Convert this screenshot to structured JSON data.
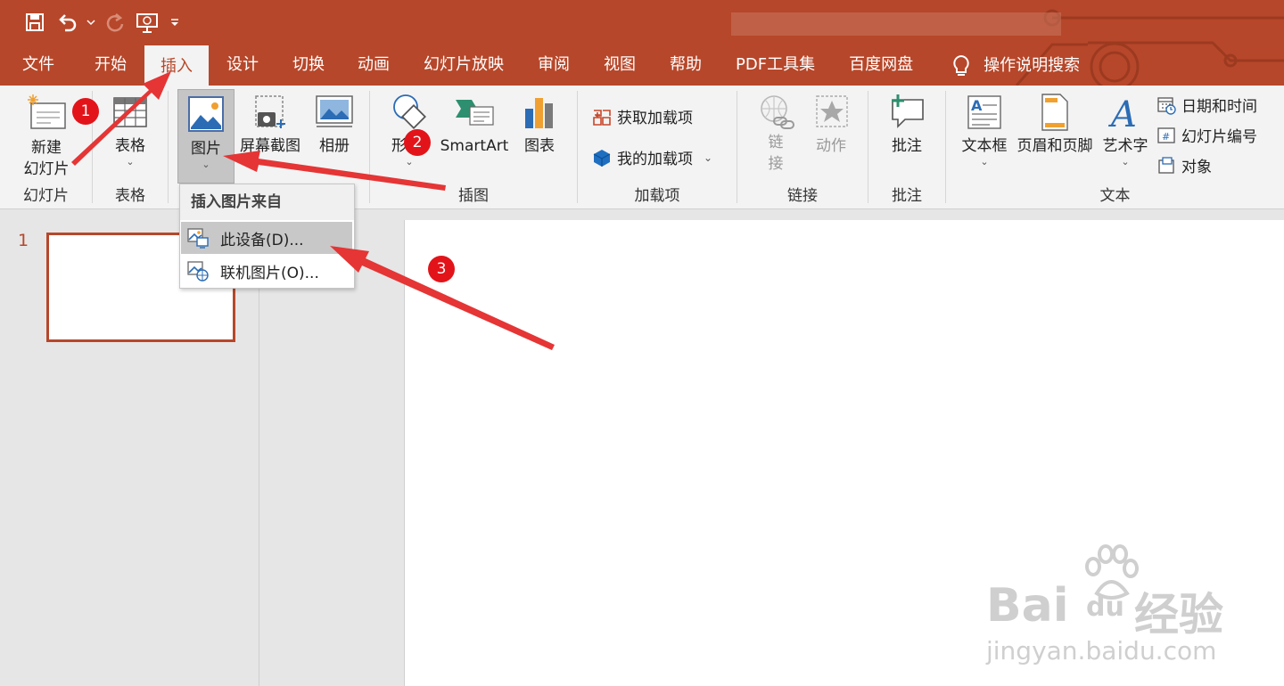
{
  "colors": {
    "accent": "#b7472a",
    "ribbon_bg": "#f3f3f3",
    "badge": "#e2141a",
    "arrow": "#e53535"
  },
  "qat": {
    "items": [
      {
        "icon": "save-icon"
      },
      {
        "icon": "undo-icon"
      },
      {
        "icon": "redo-icon"
      },
      {
        "icon": "present-from-start-icon"
      },
      {
        "icon": "customize-qat-icon"
      }
    ]
  },
  "tabs": [
    {
      "label": "文件",
      "active": false
    },
    {
      "label": "开始",
      "active": false
    },
    {
      "label": "插入",
      "active": true
    },
    {
      "label": "设计",
      "active": false
    },
    {
      "label": "切换",
      "active": false
    },
    {
      "label": "动画",
      "active": false
    },
    {
      "label": "幻灯片放映",
      "active": false
    },
    {
      "label": "审阅",
      "active": false
    },
    {
      "label": "视图",
      "active": false
    },
    {
      "label": "帮助",
      "active": false
    },
    {
      "label": "PDF工具集",
      "active": false
    },
    {
      "label": "百度网盘",
      "active": false
    }
  ],
  "tell_me": {
    "icon": "lightbulb-icon",
    "label": "操作说明搜索"
  },
  "ribbon": {
    "slides_group": {
      "label": "幻灯片",
      "new_slide_line1": "新建",
      "new_slide_line2": "幻灯片"
    },
    "tables_group": {
      "label": "表格",
      "table": "表格"
    },
    "images_group": {
      "pictures": "图片",
      "screenshot": "屏幕截图",
      "album": "相册"
    },
    "illustrations_group": {
      "label": "插图",
      "shapes": "形",
      "smartart": "SmartArt",
      "chart": "图表"
    },
    "addins_group": {
      "label": "加载项",
      "get_addins": "获取加载项",
      "my_addins": "我的加载项"
    },
    "links_group": {
      "label": "链接",
      "link_line1": "链",
      "link_line2": "接",
      "action": "动作"
    },
    "comments_group": {
      "label": "批注",
      "comment": "批注"
    },
    "text_group": {
      "label": "文本",
      "textbox": "文本框",
      "header_footer": "页眉和页脚",
      "wordart": "艺术字",
      "datetime": "日期和时间",
      "slide_number": "幻灯片编号",
      "object": "对象"
    }
  },
  "dropdown": {
    "header": "插入图片来自",
    "items": [
      {
        "label": "此设备(D)...",
        "icon": "this-device-icon"
      },
      {
        "label": "联机图片(O)...",
        "icon": "online-pictures-icon"
      }
    ]
  },
  "slides_pane": {
    "slide_number": "1"
  },
  "annotations": {
    "badge1": "1",
    "badge2": "2",
    "badge3": "3"
  },
  "watermark": {
    "brand": "Bai",
    "brand2": "du",
    "cn": "经验",
    "url": "jingyan.baidu.com"
  }
}
